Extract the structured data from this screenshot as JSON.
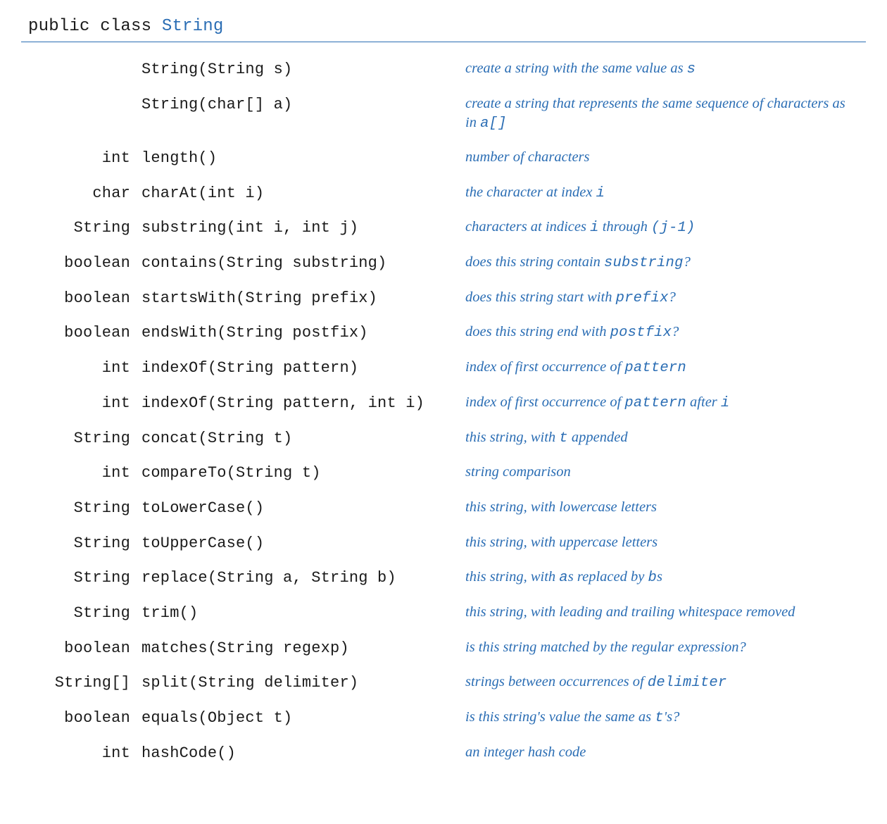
{
  "header": {
    "prefix": "public class ",
    "classname": "String"
  },
  "rows": [
    {
      "ret": "",
      "sig": "String(String s)",
      "desc": [
        {
          "t": "create a string with the same value as "
        },
        {
          "t": "s",
          "code": true
        }
      ]
    },
    {
      "ret": "",
      "sig": "String(char[] a)",
      "desc": [
        {
          "t": "create a string that represents the same sequence of characters as in "
        },
        {
          "t": "a[]",
          "code": true
        }
      ]
    },
    {
      "ret": "int",
      "sig": "length()",
      "desc": [
        {
          "t": "number of characters"
        }
      ]
    },
    {
      "ret": "char",
      "sig": "charAt(int i)",
      "desc": [
        {
          "t": "the character at index "
        },
        {
          "t": "i",
          "code": true
        }
      ]
    },
    {
      "ret": "String",
      "sig": "substring(int i, int j)",
      "desc": [
        {
          "t": "characters at indices "
        },
        {
          "t": "i",
          "code": true
        },
        {
          "t": " through "
        },
        {
          "t": "(j-1)",
          "code": true
        }
      ]
    },
    {
      "ret": "boolean",
      "sig": "contains(String substring)",
      "desc": [
        {
          "t": "does this string contain "
        },
        {
          "t": "substring",
          "code": true
        },
        {
          "t": "?"
        }
      ]
    },
    {
      "ret": "boolean",
      "sig": "startsWith(String prefix)",
      "desc": [
        {
          "t": "does this string start with "
        },
        {
          "t": "prefix",
          "code": true
        },
        {
          "t": "?"
        }
      ]
    },
    {
      "ret": "boolean",
      "sig": "endsWith(String postfix)",
      "desc": [
        {
          "t": "does this string end with "
        },
        {
          "t": "postfix",
          "code": true
        },
        {
          "t": "?"
        }
      ]
    },
    {
      "ret": "int",
      "sig": "indexOf(String pattern)",
      "desc": [
        {
          "t": "index of first occurrence of "
        },
        {
          "t": "pattern",
          "code": true
        }
      ]
    },
    {
      "ret": "int",
      "sig": "indexOf(String pattern, int i)",
      "desc": [
        {
          "t": "index of first occurrence of "
        },
        {
          "t": "pattern",
          "code": true
        },
        {
          "t": " after "
        },
        {
          "t": "i",
          "code": true
        }
      ]
    },
    {
      "ret": "String",
      "sig": "concat(String t)",
      "desc": [
        {
          "t": "this string, with "
        },
        {
          "t": "t",
          "code": true
        },
        {
          "t": " appended"
        }
      ]
    },
    {
      "ret": "int",
      "sig": "compareTo(String t)",
      "desc": [
        {
          "t": "string comparison"
        }
      ]
    },
    {
      "ret": "String",
      "sig": "toLowerCase()",
      "desc": [
        {
          "t": "this string, with lowercase letters"
        }
      ]
    },
    {
      "ret": "String",
      "sig": "toUpperCase()",
      "desc": [
        {
          "t": "this string, with uppercase letters"
        }
      ]
    },
    {
      "ret": "String",
      "sig": "replace(String a, String b)",
      "desc": [
        {
          "t": "this string, with "
        },
        {
          "t": "a",
          "code": true
        },
        {
          "t": "s replaced by "
        },
        {
          "t": "b",
          "code": true
        },
        {
          "t": "s"
        }
      ]
    },
    {
      "ret": "String",
      "sig": "trim()",
      "desc": [
        {
          "t": "this string, with leading and trailing whitespace removed"
        }
      ]
    },
    {
      "ret": "boolean",
      "sig": "matches(String regexp)",
      "desc": [
        {
          "t": "is this string matched by the regular expression?"
        }
      ]
    },
    {
      "ret": "String[]",
      "sig": "split(String delimiter)",
      "desc": [
        {
          "t": "strings between occurrences of "
        },
        {
          "t": "delimiter",
          "code": true
        }
      ]
    },
    {
      "ret": "boolean",
      "sig": "equals(Object t)",
      "desc": [
        {
          "t": "is this string's value the same as "
        },
        {
          "t": "t",
          "code": true
        },
        {
          "t": "'s?"
        }
      ]
    },
    {
      "ret": "int",
      "sig": "hashCode()",
      "desc": [
        {
          "t": "an integer hash code"
        }
      ]
    }
  ]
}
